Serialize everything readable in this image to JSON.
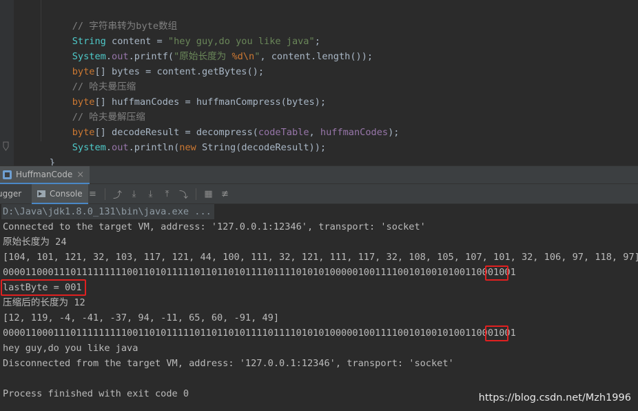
{
  "editor": {
    "lines": [
      {
        "comment": "// 字符串转为byte数组"
      },
      {
        "t1": "String",
        "t2": " content = ",
        "t3": "\"hey guy,do you like java\"",
        "t4": ";"
      },
      {
        "t1": "System",
        "t2": ".",
        "t3": "out",
        "t4": ".printf(",
        "t5": "\"原始长度为 ",
        "t6": "%d\\n",
        "t7": "\"",
        "t8": ", content.length());"
      },
      {
        "t1": "byte",
        "t2": "[] bytes = content.getBytes();"
      },
      {
        "comment": "// 哈夫曼压缩"
      },
      {
        "t1": "byte",
        "t2": "[] huffmanCodes = huffmanCompress(bytes);"
      },
      {
        "comment": "// 哈夫曼解压缩"
      },
      {
        "t1": "byte",
        "t2": "[] decodeResult = decompress(",
        "t3": "codeTable",
        "t4": ", ",
        "t5": "huffmanCodes",
        "t6": ");"
      },
      {
        "t1": "System",
        "t2": ".",
        "t3": "out",
        "t4": ".println(",
        "t5": "new",
        "t6": " String(decodeResult));"
      },
      {
        "t1": "}"
      }
    ]
  },
  "run": {
    "tab_label": "HuffmanCode",
    "close_glyph": "×",
    "debugger_label": "ugger",
    "console_label": "Console"
  },
  "toolbar_icons": [
    "≡",
    "⤴",
    "⤓",
    "⤓",
    "⤒",
    "⤵",
    "▦",
    "≢"
  ],
  "console": {
    "lines": [
      "D:\\Java\\jdk1.8.0_131\\bin\\java.exe ...",
      "Connected to the target VM, address: '127.0.0.1:12346', transport: 'socket'",
      "原始长度为 24",
      "[104, 101, 121, 32, 103, 117, 121, 44, 100, 111, 32, 121, 111, 117, 32, 108, 105, 107, 101, 32, 106, 97, 118, 97]",
      "0000110001110111111111001101011111011011010111101111010101000001001111001010010100110001001",
      "lastByte = 001",
      "压缩后的长度为 12",
      "[12, 119, -4, -41, -37, 94, -11, 65, 60, -91, 49]",
      "0000110001110111111111001101011111011011010111101111010101000001001111001010010100110001001",
      "hey guy,do you like java",
      "Disconnected from the target VM, address: '127.0.0.1:12346', transport: 'socket'",
      "",
      "Process finished with exit code 0"
    ]
  },
  "watermark": "https://blog.csdn.net/Mzh1996",
  "colors": {
    "editor_bg": "#2b2b2b",
    "highlight_box": "#e02020",
    "keyword": "#cc7832",
    "string": "#6a8759",
    "comment": "#808080"
  }
}
